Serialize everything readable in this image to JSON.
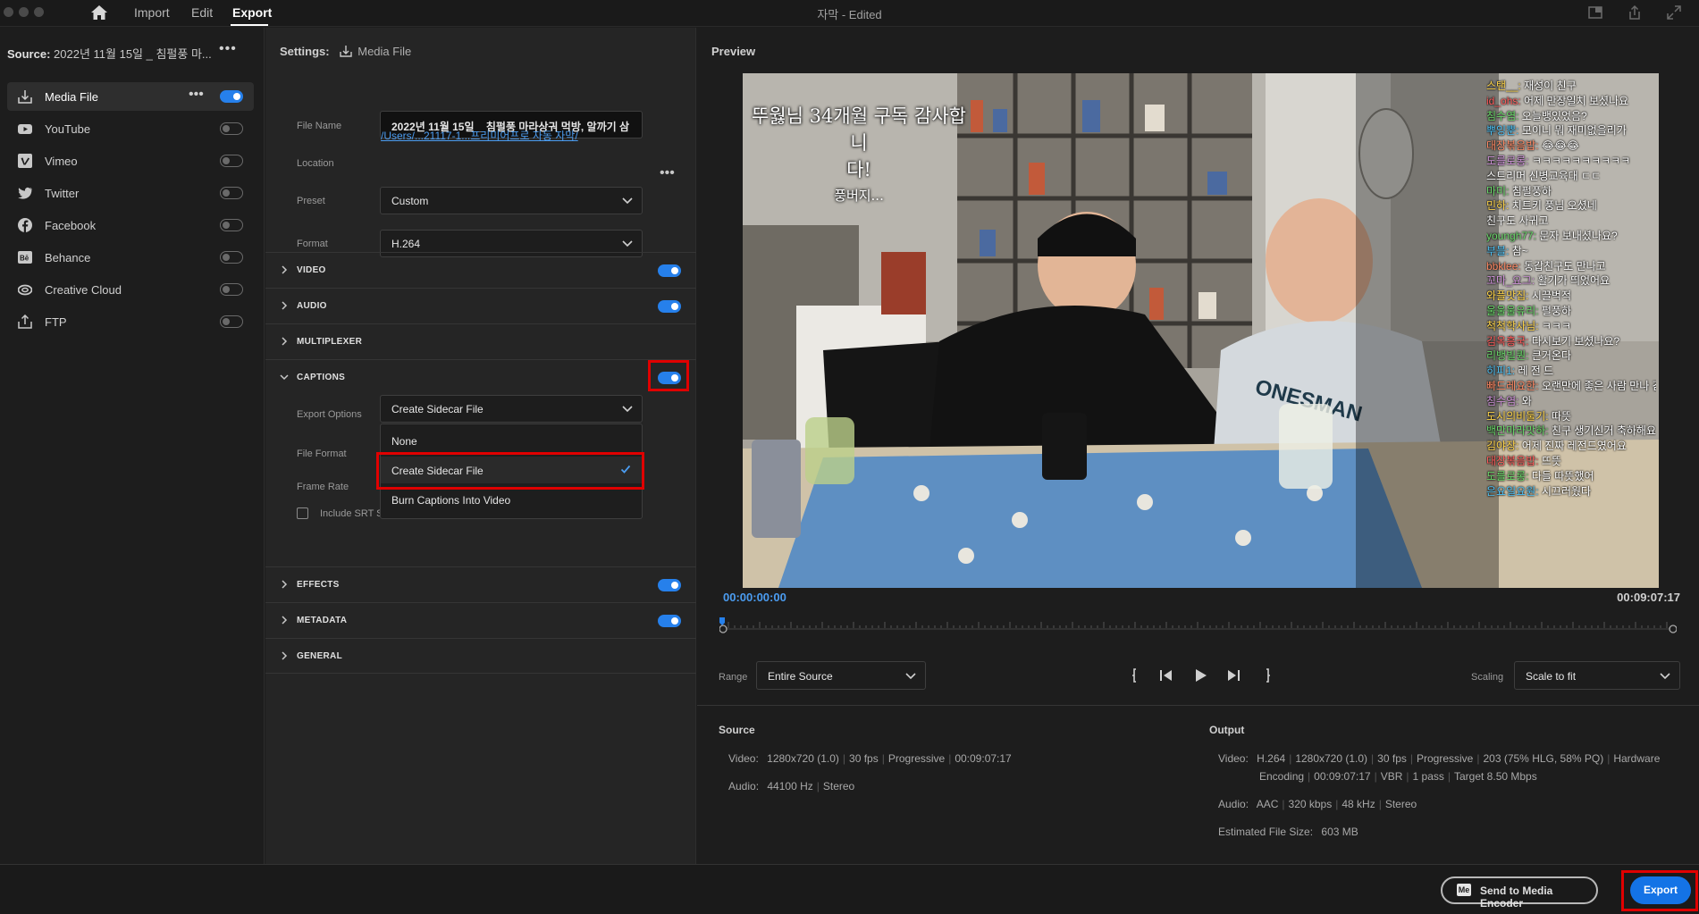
{
  "app": {
    "title": "자막 - Edited"
  },
  "nav": {
    "import_label": "Import",
    "edit_label": "Edit",
    "export_label": "Export"
  },
  "source": {
    "label": "Source:",
    "value": "2022년 11월 15일 _ 침펄풍 마..."
  },
  "destinations": [
    {
      "label": "Media File",
      "icon": "media-file-icon",
      "enabled": true,
      "selected": true
    },
    {
      "label": "YouTube",
      "icon": "youtube-icon",
      "enabled": false
    },
    {
      "label": "Vimeo",
      "icon": "vimeo-icon",
      "enabled": false
    },
    {
      "label": "Twitter",
      "icon": "twitter-icon",
      "enabled": false
    },
    {
      "label": "Facebook",
      "icon": "facebook-icon",
      "enabled": false
    },
    {
      "label": "Behance",
      "icon": "behance-icon",
      "enabled": false
    },
    {
      "label": "Creative Cloud",
      "icon": "creative-cloud-icon",
      "enabled": false
    },
    {
      "label": "FTP",
      "icon": "ftp-upload-icon",
      "enabled": false
    }
  ],
  "settings": {
    "heading": "Settings:",
    "target": "Media File",
    "file_name_label": "File Name",
    "file_name_value": "2022년 11월 15일 _ 침펄풍 마라상궈 먹방, 알까기 삼",
    "location_label": "Location",
    "location_value": "/Users/...21117-1...프리미어프로 자동 자막/",
    "preset_label": "Preset",
    "preset_value": "Custom",
    "format_label": "Format",
    "format_value": "H.264",
    "sections": {
      "video": {
        "label": "VIDEO",
        "enabled": true
      },
      "audio": {
        "label": "AUDIO",
        "enabled": true
      },
      "multiplexer": {
        "label": "MULTIPLEXER"
      },
      "captions": {
        "label": "CAPTIONS",
        "enabled": true
      },
      "effects": {
        "label": "EFFECTS",
        "enabled": true
      },
      "metadata": {
        "label": "METADATA",
        "enabled": true
      },
      "general": {
        "label": "GENERAL"
      }
    },
    "captions": {
      "export_options_label": "Export Options",
      "export_options_value": "Create Sidecar File",
      "file_format_label": "File Format",
      "frame_rate_label": "Frame Rate",
      "include_srt_label": "Include SRT St",
      "menu": [
        "None",
        "Create Sidecar File",
        "Burn Captions Into Video"
      ],
      "menu_selected": "Create Sidecar File"
    }
  },
  "preview": {
    "title": "Preview",
    "timecode_start": "00:00:00:00",
    "timecode_end": "00:09:07:17",
    "range_label": "Range",
    "range_value": "Entire Source",
    "scaling_label": "Scaling",
    "scaling_value": "Scale to fit",
    "overlay_text_1": "뚜웛님 34개월 구독 감사합니",
    "overlay_text_2": "다!",
    "overlay_text_3": "풍버지...",
    "chat": [
      "스탠__: 재성이 친구",
      "id_ohs: 어제 만장일치 보셨나요",
      "침수염: 오늘뱅있었음?",
      "뿌잉뿐: 모이니 뭐 재미없을리가",
      "대장볶음밥: 😂😂😂",
      "도를로롱: ㅋㅋㅋㅋㅋㅋㅋㅋㅋㅋ",
      "스트리머 신병교육대 ㄷㄷ",
      "마미: 침펄풍하",
      "민하: 치트키 풍님 오셨네",
      "친구도 사귀고",
      "youngh77: 문자 보내셨나요?",
      "부블: 참~",
      "bbklee: 동갑친구도 만나고",
      "꼬마_요그: 활기가 띄었어요",
      "와플맛집: 시끌벅적",
      "울울울유리: 펄풍하",
      "척척학사님: ㅋㅋㅋ",
      "김옥흥국: 다시보기 보셨나요?",
      "리뱅빌퀀: 큰거온다",
      "히피1: 레 전 드",
      "빠드레요한: 오랜만에 좋은 사람 만나 감사하다",
      "침수염: 와",
      "도시의비둘기: 따뜻",
      "백만마라맛하: 친구 생기신거 축하해요",
      "김야장: 어제 진짜 레전드였어요",
      "대장볶음밥: 뜨뜻",
      "도를로롱: 다들 따뜻했어",
      "은요일요원: 시끄러웠다"
    ]
  },
  "source_info": {
    "heading": "Source",
    "video_label": "Video:",
    "video_values": [
      "1280x720 (1.0)",
      "30 fps",
      "Progressive",
      "00:09:07:17"
    ],
    "audio_label": "Audio:",
    "audio_values": [
      "44100 Hz",
      "Stereo"
    ]
  },
  "output_info": {
    "heading": "Output",
    "video_label": "Video:",
    "video_values": [
      "H.264",
      "1280x720 (1.0)",
      "30 fps",
      "Progressive",
      "203 (75% HLG, 58% PQ)",
      "Hardware"
    ],
    "video_values_2": [
      "Encoding",
      "00:09:07:17",
      "VBR",
      "1 pass",
      "Target 8.50 Mbps"
    ],
    "audio_label": "Audio:",
    "audio_values": [
      "AAC",
      "320 kbps",
      "48 kHz",
      "Stereo"
    ],
    "size_label": "Estimated File Size:",
    "size_value": "603 MB"
  },
  "footer": {
    "send_badge": "Me",
    "send_label": "Send to Media Encoder",
    "export_label": "Export"
  },
  "colors": {
    "accent": "#2680eb",
    "highlight": "#e00000",
    "link": "#4b9cf0"
  }
}
